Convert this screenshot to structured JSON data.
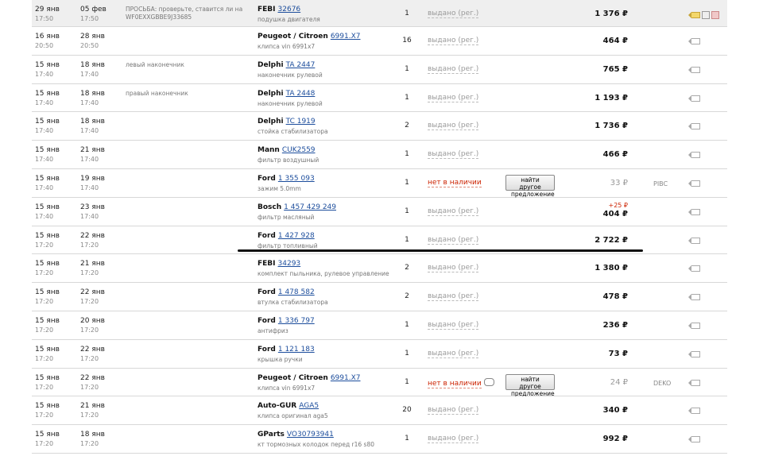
{
  "rows": [
    {
      "d1": "29 янв",
      "t1": "17:50",
      "d2": "05 фев",
      "t2": "17:50",
      "comment": "ПРОСЬБА: проверьте, ставится ли на WF0EXXGBBE9J33685",
      "brand": "FEBI",
      "code": "32676",
      "desc": "подушка двигателя",
      "qty": "1",
      "status": "выдано (рег.)",
      "status_type": "ok",
      "price": "1 376 ₽",
      "supplier": "",
      "tag": "yellow",
      "alt": ""
    },
    {
      "d1": "16 янв",
      "t1": "20:50",
      "d2": "28 янв",
      "t2": "20:50",
      "comment": "",
      "brand": "Peugeot / Citroen",
      "code": "6991.X7",
      "desc": "клипса vin 6991x7",
      "qty": "16",
      "status": "выдано (рег.)",
      "status_type": "ok",
      "price": "464 ₽",
      "supplier": "",
      "tag": "plain",
      "alt": ""
    },
    {
      "d1": "15 янв",
      "t1": "17:40",
      "d2": "18 янв",
      "t2": "17:40",
      "comment": "левый наконечник",
      "brand": "Delphi",
      "code": "TA 2447",
      "desc": "наконечник рулевой",
      "qty": "1",
      "status": "выдано (рег.)",
      "status_type": "ok",
      "price": "765 ₽",
      "supplier": "",
      "tag": "plain",
      "alt": ""
    },
    {
      "d1": "15 янв",
      "t1": "17:40",
      "d2": "18 янв",
      "t2": "17:40",
      "comment": "правый наконечник",
      "brand": "Delphi",
      "code": "TA 2448",
      "desc": "наконечник рулевой",
      "qty": "1",
      "status": "выдано (рег.)",
      "status_type": "ok",
      "price": "1 193 ₽",
      "supplier": "",
      "tag": "plain",
      "alt": ""
    },
    {
      "d1": "15 янв",
      "t1": "17:40",
      "d2": "18 янв",
      "t2": "17:40",
      "comment": "",
      "brand": "Delphi",
      "code": "TC 1919",
      "desc": "стойка стабилизатора",
      "qty": "2",
      "status": "выдано (рег.)",
      "status_type": "ok",
      "price": "1 736 ₽",
      "supplier": "",
      "tag": "plain",
      "alt": ""
    },
    {
      "d1": "15 янв",
      "t1": "17:40",
      "d2": "21 янв",
      "t2": "17:40",
      "comment": "",
      "brand": "Mann",
      "code": "CUK2559",
      "desc": "фильтр воздушный",
      "qty": "1",
      "status": "выдано (рег.)",
      "status_type": "ok",
      "price": "466 ₽",
      "supplier": "",
      "tag": "plain",
      "alt": ""
    },
    {
      "d1": "15 янв",
      "t1": "17:40",
      "d2": "19 янв",
      "t2": "17:40",
      "comment": "",
      "brand": "Ford",
      "code": "1 355 093",
      "desc": "зажим 5.0mm",
      "qty": "1",
      "status": "нет в наличии",
      "status_type": "no",
      "price": "33 ₽",
      "price_muted": true,
      "supplier": "PIBC",
      "tag": "plain",
      "alt": "найти другое предложение"
    },
    {
      "d1": "15 янв",
      "t1": "17:40",
      "d2": "23 янв",
      "t2": "17:40",
      "comment": "",
      "brand": "Bosch",
      "code": "1 457 429 249",
      "desc": "фильтр масляный",
      "qty": "1",
      "status": "выдано (рег.)",
      "status_type": "ok",
      "price": "404 ₽",
      "price_plus": "+25 ₽",
      "supplier": "",
      "tag": "plain",
      "alt": ""
    },
    {
      "d1": "15 янв",
      "t1": "17:20",
      "d2": "22 янв",
      "t2": "17:20",
      "comment": "",
      "brand": "Ford",
      "code": "1 427 928",
      "desc": "фильтр топливный",
      "qty": "1",
      "status": "выдано (рег.)",
      "status_type": "ok",
      "price": "2 722 ₽",
      "supplier": "",
      "tag": "plain",
      "alt": ""
    },
    {
      "d1": "15 янв",
      "t1": "17:20",
      "d2": "21 янв",
      "t2": "17:20",
      "comment": "",
      "brand": "FEBI",
      "code": "34293",
      "desc": "комплект пыльника, рулевое управление",
      "qty": "2",
      "status": "выдано (рег.)",
      "status_type": "ok",
      "price": "1 380 ₽",
      "supplier": "",
      "tag": "plain",
      "alt": ""
    },
    {
      "d1": "15 янв",
      "t1": "17:20",
      "d2": "22 янв",
      "t2": "17:20",
      "comment": "",
      "brand": "Ford",
      "code": "1 478 582",
      "desc": "втулка стабилизатора",
      "qty": "2",
      "status": "выдано (рег.)",
      "status_type": "ok",
      "price": "478 ₽",
      "supplier": "",
      "tag": "plain",
      "alt": ""
    },
    {
      "d1": "15 янв",
      "t1": "17:20",
      "d2": "20 янв",
      "t2": "17:20",
      "comment": "",
      "brand": "Ford",
      "code": "1 336 797",
      "desc": "антифриз",
      "qty": "1",
      "status": "выдано (рег.)",
      "status_type": "ok",
      "price": "236 ₽",
      "supplier": "",
      "tag": "plain",
      "alt": ""
    },
    {
      "d1": "15 янв",
      "t1": "17:20",
      "d2": "22 янв",
      "t2": "17:20",
      "comment": "",
      "brand": "Ford",
      "code": "1 121 183",
      "desc": "крышка ручки",
      "qty": "1",
      "status": "выдано (рег.)",
      "status_type": "ok",
      "price": "73 ₽",
      "supplier": "",
      "tag": "plain",
      "alt": ""
    },
    {
      "d1": "15 янв",
      "t1": "17:20",
      "d2": "22 янв",
      "t2": "17:20",
      "comment": "",
      "brand": "Peugeot / Citroen",
      "code": "6991.X7",
      "desc": "клипса vin 6991x7",
      "qty": "1",
      "status": "нет в наличии",
      "status_type": "no",
      "bubble": true,
      "price": "24 ₽",
      "price_muted": true,
      "supplier": "DEKO",
      "tag": "plain",
      "alt": "найти другое предложение"
    },
    {
      "d1": "15 янв",
      "t1": "17:20",
      "d2": "21 янв",
      "t2": "17:20",
      "comment": "",
      "brand": "Auto-GUR",
      "code": "AGA5",
      "desc": "клипса оригинал aga5",
      "qty": "20",
      "status": "выдано (рег.)",
      "status_type": "ok",
      "price": "340 ₽",
      "supplier": "",
      "tag": "plain",
      "alt": ""
    },
    {
      "d1": "15 янв",
      "t1": "17:20",
      "d2": "18 янв",
      "t2": "17:20",
      "comment": "",
      "brand": "GParts",
      "code": "VO30793941",
      "desc": "кт тормозных колодок перед r16 s80",
      "qty": "1",
      "status": "выдано (рег.)",
      "status_type": "ok",
      "price": "992 ₽",
      "supplier": "",
      "tag": "plain",
      "alt": ""
    }
  ]
}
